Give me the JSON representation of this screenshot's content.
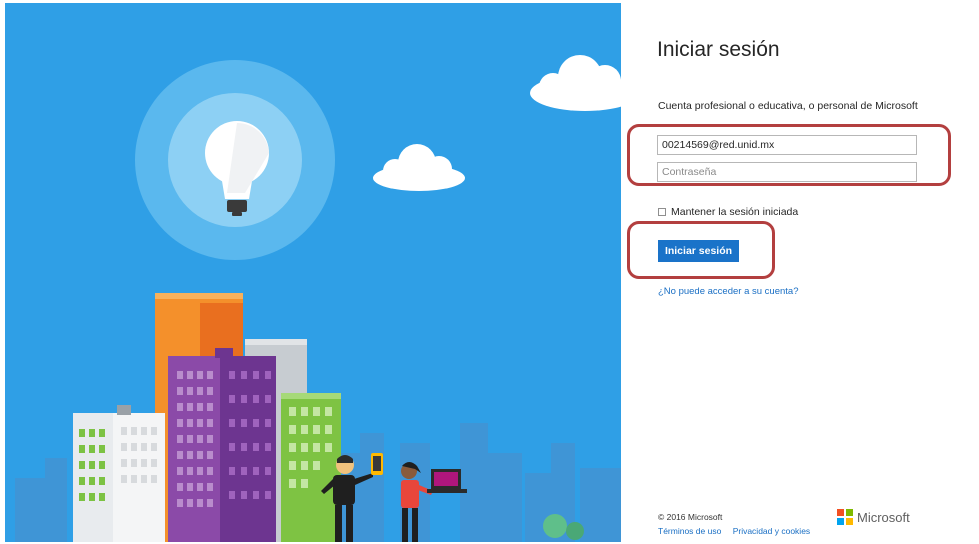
{
  "signin": {
    "title": "Iniciar sesión",
    "subtitle": "Cuenta profesional o educativa, o personal de Microsoft",
    "email_value": "00214569@red.unid.mx",
    "password_placeholder": "Contraseña",
    "keep_signed_in": "Mantener la sesión iniciada",
    "keep_signed_in_checked": false,
    "signin_button": "Iniciar sesión",
    "cant_access": "¿No puede acceder a su cuenta?"
  },
  "footer": {
    "copyright": "© 2016 Microsoft",
    "terms": "Términos de uso",
    "privacy": "Privacidad y cookies",
    "brand": "Microsoft"
  },
  "colors": {
    "sky": "#2f9fe6",
    "button": "#1a73c9",
    "link": "#1a6fc4",
    "annotation": "#b33f3f"
  },
  "icons": [
    "lightbulb-icon",
    "cloud-icon",
    "microsoft-logo-icon",
    "checkbox-icon"
  ]
}
